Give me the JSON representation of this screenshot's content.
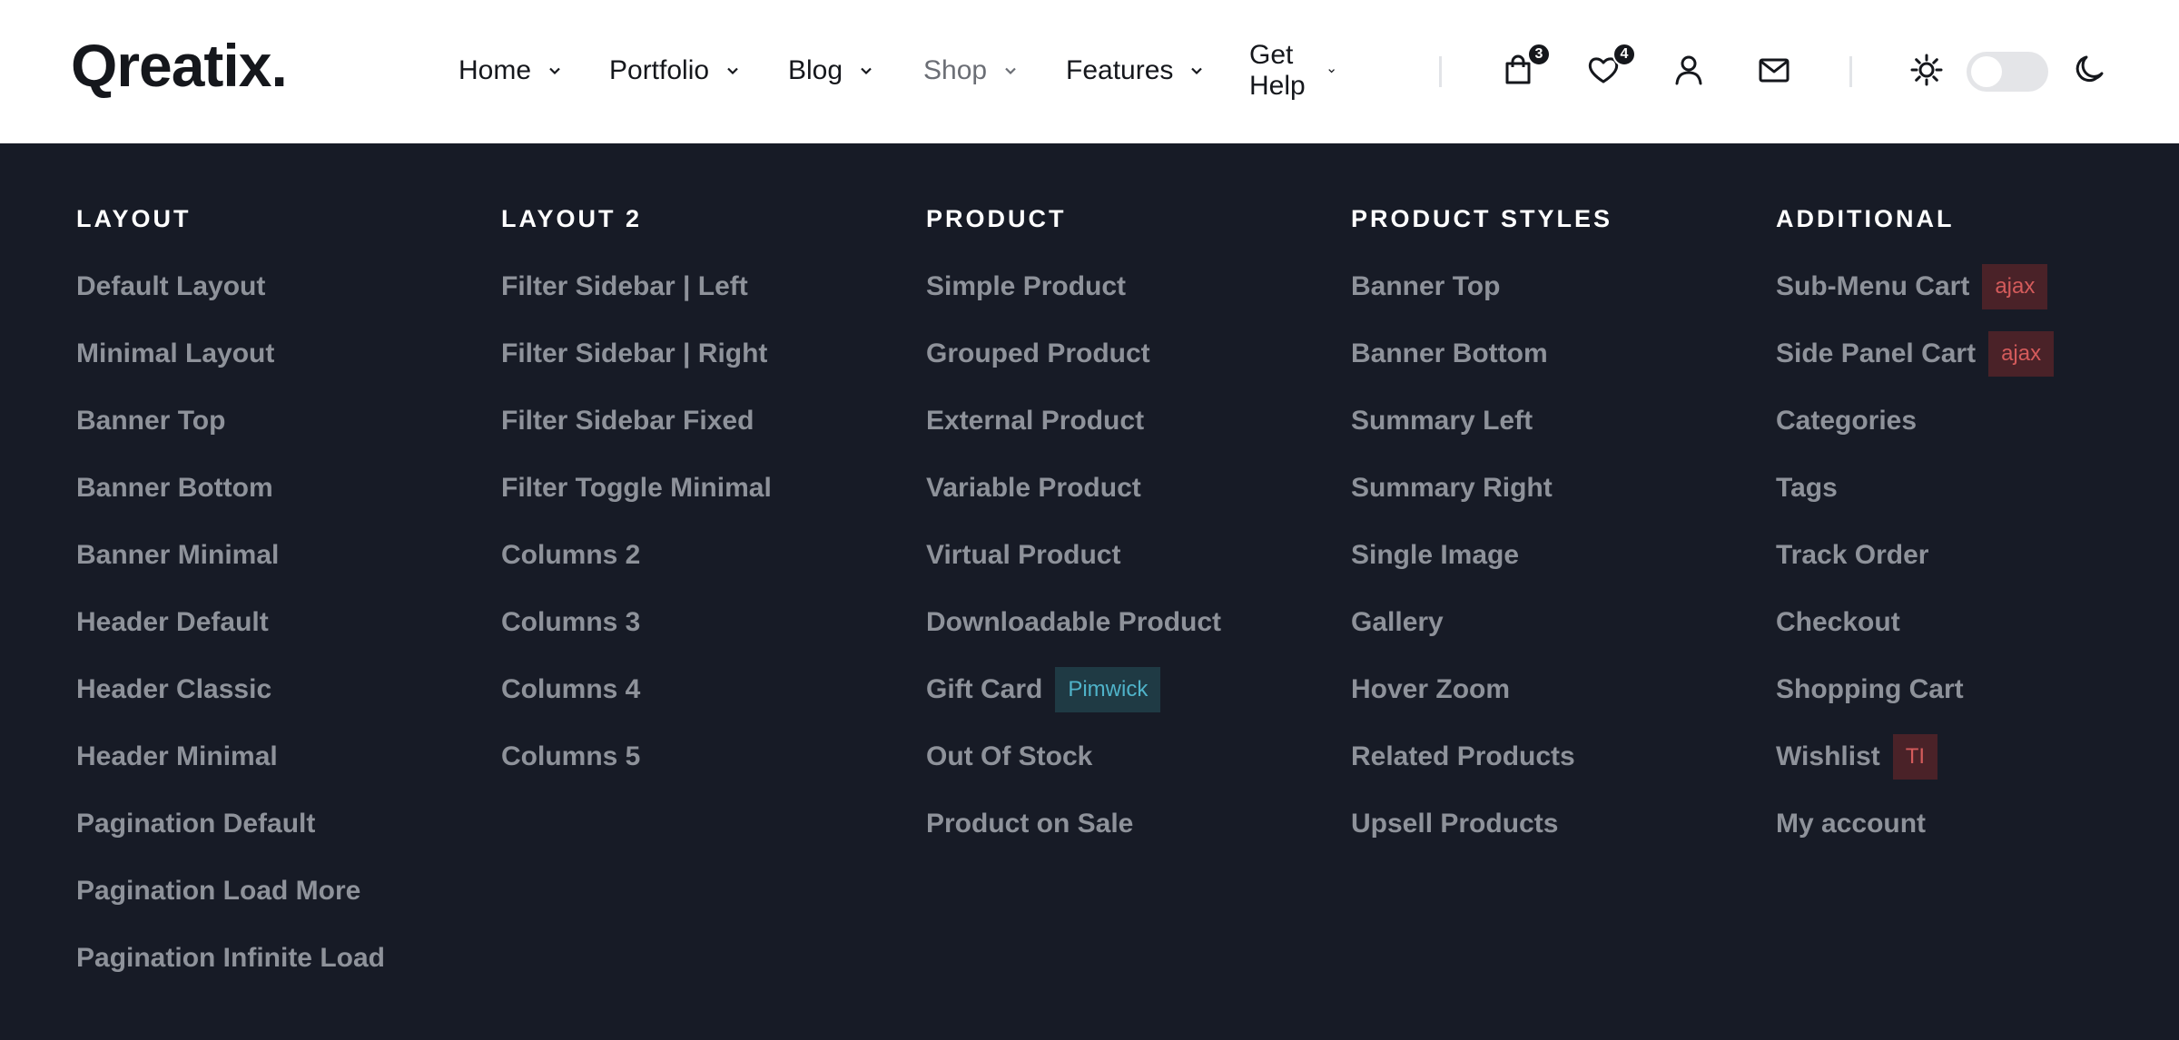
{
  "brand": {
    "name": "Qreatix."
  },
  "nav": [
    {
      "label": "Home"
    },
    {
      "label": "Portfolio"
    },
    {
      "label": "Blog"
    },
    {
      "label": "Shop"
    },
    {
      "label": "Features"
    },
    {
      "label": "Get Help"
    }
  ],
  "header_icons": {
    "bag_count": "3",
    "wishlist_count": "4"
  },
  "mega_menu": {
    "columns": [
      {
        "title": "LAYOUT",
        "links": [
          {
            "label": "Default Layout"
          },
          {
            "label": "Minimal Layout"
          },
          {
            "label": "Banner Top"
          },
          {
            "label": "Banner Bottom"
          },
          {
            "label": "Banner Minimal"
          },
          {
            "label": "Header Default"
          },
          {
            "label": "Header Classic"
          },
          {
            "label": "Header Minimal"
          },
          {
            "label": "Pagination Default"
          },
          {
            "label": "Pagination Load More"
          },
          {
            "label": "Pagination Infinite Load"
          }
        ]
      },
      {
        "title": "LAYOUT 2",
        "links": [
          {
            "label": "Filter Sidebar | Left"
          },
          {
            "label": "Filter Sidebar | Right"
          },
          {
            "label": "Filter Sidebar Fixed"
          },
          {
            "label": "Filter Toggle Minimal"
          },
          {
            "label": "Columns 2"
          },
          {
            "label": "Columns 3"
          },
          {
            "label": "Columns 4"
          },
          {
            "label": "Columns 5"
          }
        ]
      },
      {
        "title": "PRODUCT",
        "links": [
          {
            "label": "Simple Product"
          },
          {
            "label": "Grouped Product"
          },
          {
            "label": "External Product"
          },
          {
            "label": "Variable Product"
          },
          {
            "label": "Virtual Product"
          },
          {
            "label": "Downloadable Product"
          },
          {
            "label": "Gift Card",
            "tag": "Pimwick"
          },
          {
            "label": "Out Of Stock"
          },
          {
            "label": "Product on Sale"
          }
        ]
      },
      {
        "title": "PRODUCT STYLES",
        "links": [
          {
            "label": "Banner Top"
          },
          {
            "label": "Banner Bottom"
          },
          {
            "label": "Summary Left"
          },
          {
            "label": "Summary Right"
          },
          {
            "label": "Single Image"
          },
          {
            "label": "Gallery"
          },
          {
            "label": "Hover Zoom"
          },
          {
            "label": "Related Products"
          },
          {
            "label": "Upsell Products"
          }
        ]
      },
      {
        "title": "ADDITIONAL",
        "links": [
          {
            "label": "Sub-Menu Cart",
            "tag": "ajax"
          },
          {
            "label": "Side Panel Cart",
            "tag": "ajax"
          },
          {
            "label": "Categories"
          },
          {
            "label": "Tags"
          },
          {
            "label": "Track Order"
          },
          {
            "label": "Checkout"
          },
          {
            "label": "Shopping Cart"
          },
          {
            "label": "Wishlist",
            "tag": "TI"
          },
          {
            "label": "My account"
          }
        ]
      }
    ]
  }
}
